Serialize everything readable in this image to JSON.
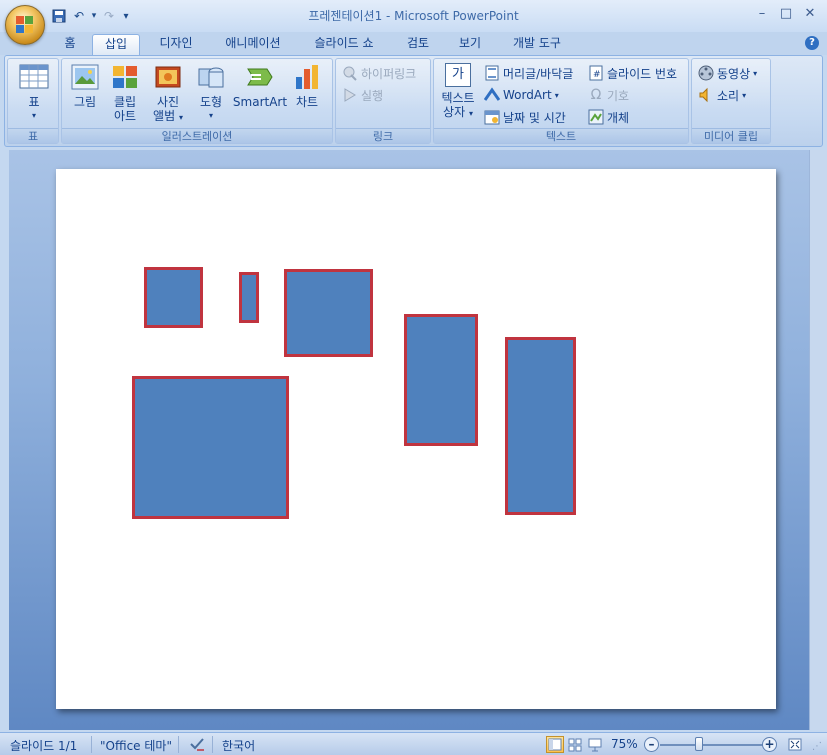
{
  "window": {
    "title": "프레젠테이션1 - Microsoft PowerPoint",
    "minimize": "–",
    "maximize": "□",
    "close": "✕",
    "help": "?"
  },
  "qat": {
    "save": "💾",
    "undo": "↶",
    "undo_drop": "▾",
    "redo": "↷",
    "customize": "▾"
  },
  "tabs": [
    {
      "label": "홈"
    },
    {
      "label": "삽입"
    },
    {
      "label": "디자인"
    },
    {
      "label": "애니메이션"
    },
    {
      "label": "슬라이드 쇼"
    },
    {
      "label": "검토"
    },
    {
      "label": "보기"
    },
    {
      "label": "개발 도구"
    }
  ],
  "active_tab": "삽입",
  "ribbon": {
    "table_group": {
      "label": "표",
      "table_btn": "표",
      "arrow": "▾"
    },
    "illustrations_group": {
      "label": "일러스트레이션",
      "picture": "그림",
      "clipart_1": "클립",
      "clipart_2": "아트",
      "album_1": "사진",
      "album_2": "앨범",
      "shapes": "도형",
      "smartart": "SmartArt",
      "chart": "차트",
      "arrow": "▾"
    },
    "links_group": {
      "label": "링크",
      "hyperlink": "하이퍼링크",
      "action": "실행"
    },
    "text_group": {
      "label": "텍스트",
      "textbox_1": "텍스트",
      "textbox_2": "상자",
      "header_footer": "머리글/바닥글",
      "wordart": "WordArt",
      "datetime": "날짜 및 시간",
      "slide_number": "슬라이드 번호",
      "symbol": "기호",
      "object": "개체",
      "textbox_icon": "가",
      "arrow": "▾"
    },
    "media_group": {
      "label": "미디어 클립",
      "movie": "동영상",
      "sound": "소리",
      "arrow": "▾"
    }
  },
  "status": {
    "slide": "슬라이드 1/1",
    "theme": "\"Office 테마\"",
    "language": "한국어",
    "zoom": "75%",
    "zoom_out": "–",
    "zoom_in": "+"
  },
  "colors": {
    "shape_fill": "#4f81bd",
    "shape_border": "#c0343f"
  }
}
